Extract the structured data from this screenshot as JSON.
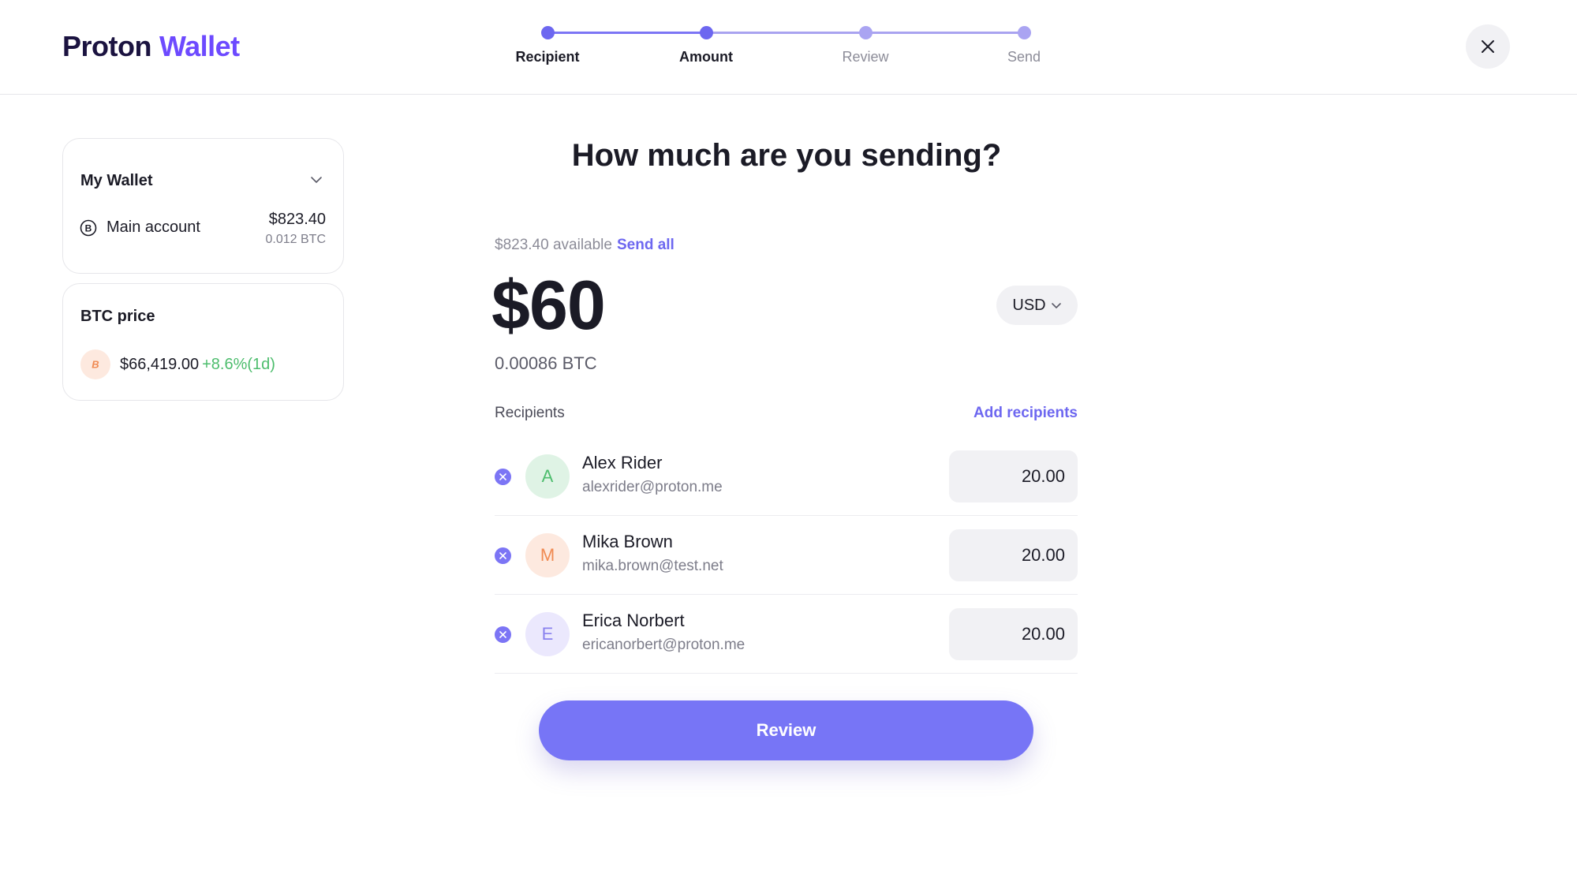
{
  "brand": {
    "part1": "Proton",
    "part2": "Wallet"
  },
  "stepper": {
    "steps": [
      {
        "label": "Recipient",
        "status": "done"
      },
      {
        "label": "Amount",
        "status": "current"
      },
      {
        "label": "Review",
        "status": "todo"
      },
      {
        "label": "Send",
        "status": "todo"
      }
    ]
  },
  "header": {
    "close_icon": "close-icon"
  },
  "wallet": {
    "name": "My Wallet",
    "account_name": "Main account",
    "balance_usd": "$823.40",
    "balance_btc": "0.012 BTC"
  },
  "btc_price": {
    "title": "BTC price",
    "value": "$66,419.00",
    "change": "+8.6%(1d)"
  },
  "main": {
    "title": "How much are you sending?",
    "available": "$823.40 available",
    "send_all": "Send all",
    "amount": "$60",
    "currency": "USD",
    "btc_equivalent": "0.00086 BTC",
    "recipients_label": "Recipients",
    "add_recipients": "Add recipients",
    "review_button": "Review"
  },
  "recipients": [
    {
      "initial": "A",
      "name": "Alex Rider",
      "email": "alexrider@proton.me",
      "amount": "20.00"
    },
    {
      "initial": "M",
      "name": "Mika Brown",
      "email": "mika.brown@test.net",
      "amount": "20.00"
    },
    {
      "initial": "E",
      "name": "Erica Norbert",
      "email": "ericanorbert@proton.me",
      "amount": "20.00"
    }
  ],
  "colors": {
    "accent": "#6d67f0",
    "brand_purple": "#6d4aff",
    "positive": "#4dbd6d",
    "btc_orange": "#f08a52"
  }
}
